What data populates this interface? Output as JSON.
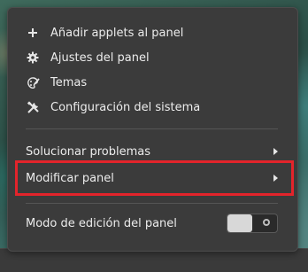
{
  "menu": {
    "items": [
      {
        "label": "Añadir applets al panel",
        "icon": "plus-icon"
      },
      {
        "label": "Ajustes del panel",
        "icon": "gear-icon"
      },
      {
        "label": "Temas",
        "icon": "palette-brush-icon"
      },
      {
        "label": "Configuración del sistema",
        "icon": "tools-icon"
      }
    ],
    "submenus": [
      {
        "label": "Solucionar problemas",
        "icon": "chevron-right-icon"
      },
      {
        "label": "Modificar panel",
        "icon": "chevron-right-icon"
      }
    ],
    "edit_mode": {
      "label": "Modo de edición del panel",
      "state": "off"
    }
  },
  "annotation": {
    "highlight_color": "#e3242b"
  }
}
